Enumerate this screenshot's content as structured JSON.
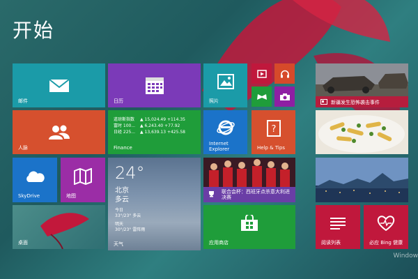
{
  "screen": {
    "title": "开始",
    "watermark": "Window"
  },
  "tiles": {
    "mail": {
      "label": "邮件",
      "color": "#1b9ba8",
      "icon": "mail-icon"
    },
    "calendar": {
      "label": "日历",
      "color": "#7b3ab8",
      "icon": "calendar-icon"
    },
    "photos": {
      "label": "照片",
      "color": "#1b9ba8",
      "icon": "photos-icon"
    },
    "video": {
      "color": "#c0183c",
      "icon": "video-icon"
    },
    "music": {
      "color": "#d64a2a",
      "icon": "headphones-icon"
    },
    "games": {
      "color": "#1f9d3a",
      "icon": "gamepad-icon"
    },
    "camera": {
      "color": "#8e1fa3",
      "icon": "camera-icon"
    },
    "people": {
      "label": "人脉",
      "color": "#d6502e",
      "icon": "people-icon"
    },
    "finance": {
      "label": "Finance",
      "color": "#1f9d3a",
      "rows": [
        {
          "name": "道琼斯指数",
          "value": "▲ 15,024.49 +114.35"
        },
        {
          "name": "富时 100...",
          "value": "▲ 6,243.40 +77.92"
        },
        {
          "name": "日经 225...",
          "value": "▲ 13,639.13 +425.58"
        }
      ]
    },
    "ie": {
      "label": "Internet Explorer",
      "color": "#1b73c9",
      "icon": "internet-explorer-icon"
    },
    "help": {
      "label": "Help & Tips",
      "color": "#d6502e",
      "icon": "help-icon"
    },
    "skydrive": {
      "label": "SkyDrive",
      "color": "#1b73c9",
      "icon": "cloud-icon"
    },
    "maps": {
      "label": "地图",
      "color": "#9b2da6",
      "icon": "map-icon"
    },
    "weather": {
      "label": "天气",
      "temp": "24°",
      "city": "北京",
      "condition": "多云",
      "today_label": "今日",
      "today": "33°/23° 多云",
      "tomorrow_label": "明天",
      "tomorrow": "30°/23° 雷阵雨"
    },
    "sports": {
      "label": "联合会杯：西班牙点杀意大利进决赛",
      "color": "#6a3ea6",
      "icon": "trophy-icon"
    },
    "news": {
      "label": "新疆发生恐怖袭击事件",
      "icon": "news-icon"
    },
    "food": {
      "icon": "food-photo"
    },
    "travel": {
      "icon": "travel-photo"
    },
    "desktop": {
      "label": "桌面"
    },
    "store": {
      "label": "应用商店",
      "color": "#1f9d3a",
      "icon": "store-icon"
    },
    "reading": {
      "label": "阅读列表",
      "color": "#c0183c",
      "icon": "reading-list-icon"
    },
    "health": {
      "label": "必应 Bing 健康",
      "color": "#c0183c",
      "icon": "health-icon"
    }
  }
}
